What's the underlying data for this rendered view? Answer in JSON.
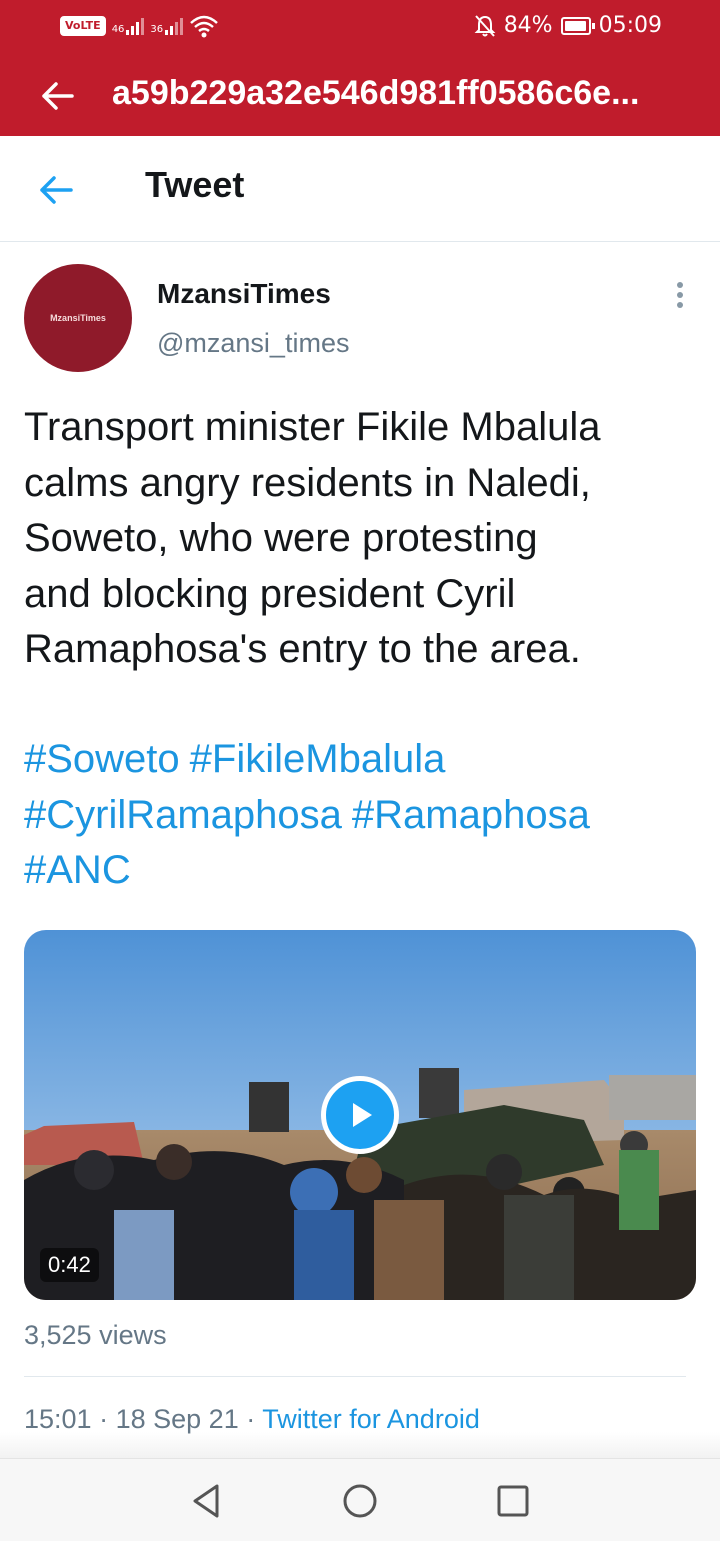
{
  "status_bar": {
    "network_left": "VoLTE",
    "sim1_label": "46",
    "sim2_label": "36",
    "battery_percent": "84%",
    "time": "05:09",
    "icons": [
      "volte-icon",
      "signal-icon",
      "wifi-icon",
      "mute-icon",
      "battery-icon"
    ]
  },
  "browser": {
    "url": "a59b229a32e546d981ff0586c6e..."
  },
  "header": {
    "title": "Tweet"
  },
  "tweet": {
    "avatar_text": "MzansiTimes",
    "display_name": "MzansiTimes",
    "handle": "@mzansi_times",
    "text_lines": [
      "Transport minister Fikile Mbalula",
      "calms angry residents in Naledi,",
      "Soweto, who were protesting",
      "and blocking president Cyril",
      "Ramaphosa's entry to the area."
    ],
    "hashtags": [
      "#Soweto",
      "#FikileMbalula",
      "#CyrilRamaphosa",
      "#Ramaphosa",
      "#ANC"
    ],
    "video_duration": "0:42",
    "views": "3,525 views",
    "time": "15:01",
    "date": "18 Sep 21",
    "separator": "·",
    "source": "Twitter for Android"
  },
  "colors": {
    "brand_red": "#c01c2c",
    "twitter_blue": "#1da1f2",
    "link_blue": "#1b95e0",
    "secondary_text": "#657786"
  }
}
